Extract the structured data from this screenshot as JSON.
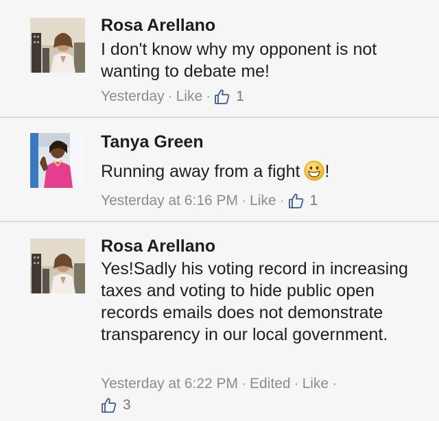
{
  "comments": [
    {
      "author": "Rosa Arellano",
      "text": "I don't know why my opponent is not wanting to debate me!",
      "time": "Yesterday",
      "like_label": "Like",
      "like_icon": "thumbs-up-icon",
      "like_count": "1"
    },
    {
      "author": "Tanya Green",
      "text": "Running away from a fight",
      "text_suffix": "!",
      "emoji": "grinning-face-icon",
      "time": "Yesterday at 6:16 PM",
      "like_label": "Like",
      "like_icon": "thumbs-up-icon",
      "like_count": "1"
    },
    {
      "author": "Rosa Arellano",
      "text": "Yes!Sadly his voting record in increasing taxes and voting to hide public open records emails does not demonstrate transparency in our local government.",
      "time": "Yesterday at 6:22 PM",
      "edited_label": "Edited",
      "like_label": "Like",
      "like_icon": "thumbs-up-icon",
      "like_count": "3"
    }
  ],
  "colors": {
    "background": "#f6f6f6",
    "author": "#1d1d1d",
    "meta": "#8b8b8b",
    "like_icon": "#3b5998",
    "divider": "#dcdcdc"
  }
}
